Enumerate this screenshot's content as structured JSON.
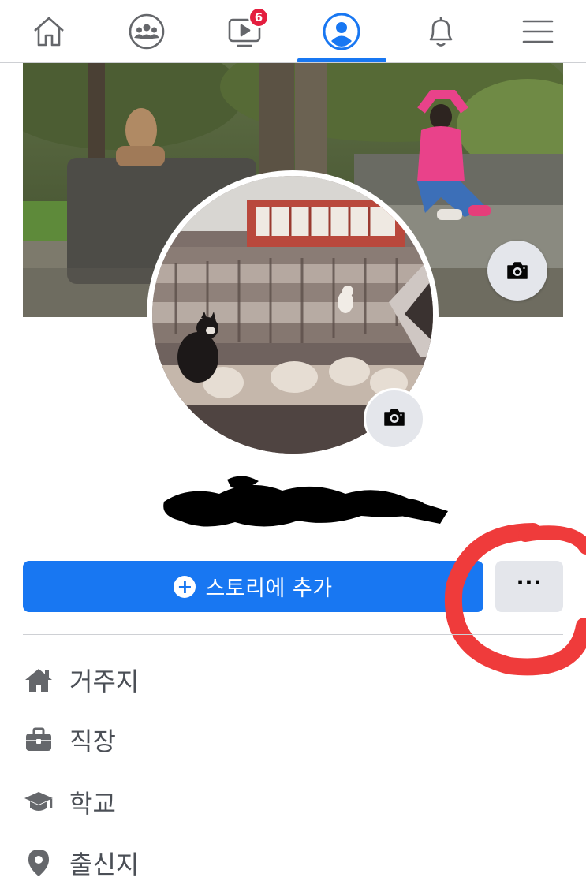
{
  "nav": {
    "items": [
      {
        "name": "home",
        "icon": "home-icon"
      },
      {
        "name": "groups",
        "icon": "groups-icon"
      },
      {
        "name": "watch",
        "icon": "watch-icon",
        "badge": "6"
      },
      {
        "name": "profile",
        "icon": "profile-icon",
        "active": true
      },
      {
        "name": "notifications",
        "icon": "bell-icon"
      },
      {
        "name": "menu",
        "icon": "hamburger-menu-icon"
      }
    ],
    "watch_badge": "6"
  },
  "profile": {
    "cover_camera_icon": "camera-icon",
    "avatar_camera_icon": "camera-icon",
    "name_redacted": true
  },
  "actions": {
    "add_story_label": "스토리에 추가",
    "more_label": "···"
  },
  "info": {
    "items": [
      {
        "icon": "home-icon",
        "label": "거주지"
      },
      {
        "icon": "briefcase-icon",
        "label": "직장"
      },
      {
        "icon": "graduation-cap-icon",
        "label": "학교"
      },
      {
        "icon": "location-pin-icon",
        "label": "출신지"
      }
    ]
  },
  "colors": {
    "accent": "#1877f2",
    "badge": "#e41e3f",
    "annotation": "#ef3b3b",
    "secondary_button": "#e4e6eb",
    "muted_text": "#4b4f56"
  }
}
